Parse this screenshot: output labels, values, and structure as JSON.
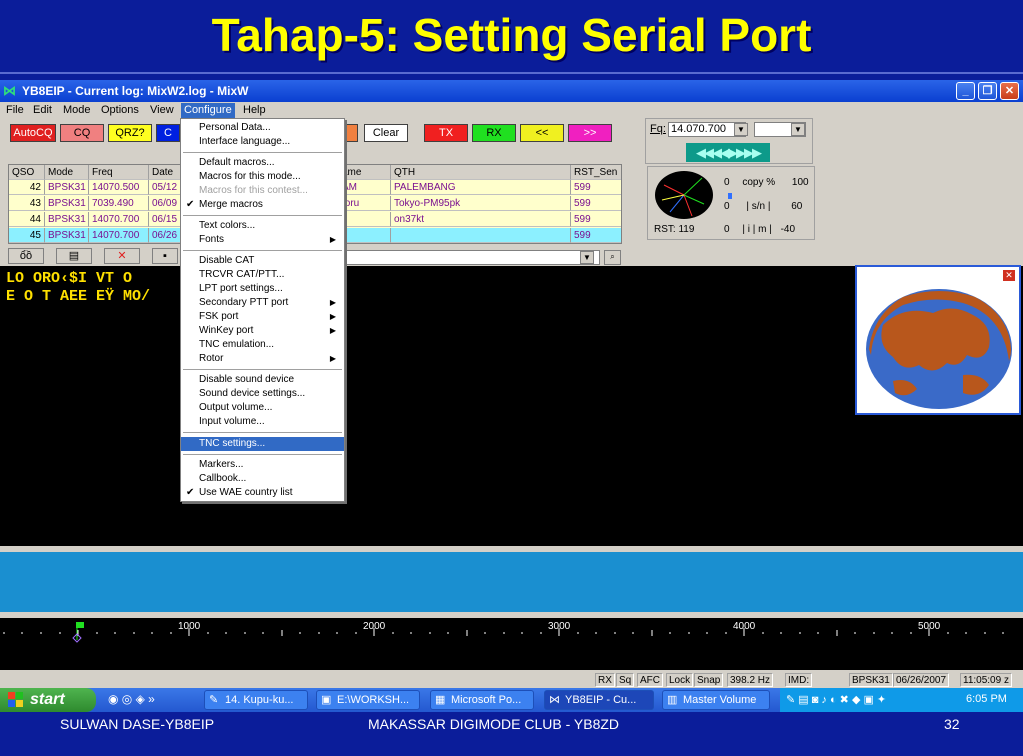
{
  "slide": {
    "title": "Tahap-5: Setting Serial Port",
    "footer_left": "SULWAN DASE-YB8EIP",
    "footer_center": "MAKASSAR DIGIMODE CLUB - YB8ZD",
    "footer_right": "32"
  },
  "window": {
    "title": "YB8EIP - Current log: MixW2.log - MixW",
    "controls": {
      "minimize": "_",
      "restore": "❐",
      "close": "✕"
    }
  },
  "menubar": [
    "File",
    "Edit",
    "Mode",
    "Options",
    "View",
    "Configure",
    "Help"
  ],
  "macro_buttons": {
    "autocq": "AutoCQ",
    "cq": "CQ",
    "qrz": "QRZ?",
    "c": "C",
    "clear": "Clear",
    "tx": "TX",
    "rx": "RX",
    "back": "<<",
    "fwd": ">>"
  },
  "freq": {
    "label": "Fq:",
    "value": "14.070.700",
    "tuner": "◀◀◀◀▶▶▶▶"
  },
  "meters": {
    "rst": "RST: 119",
    "row1": [
      "0",
      "copy %",
      "100"
    ],
    "row2": [
      "0",
      "| s/n |",
      "60"
    ],
    "row3": [
      "0",
      "| i | m |",
      "-40"
    ]
  },
  "qso_table": {
    "headers": [
      "QSO",
      "Mode",
      "Freq",
      "Date",
      "ame",
      "QTH",
      "RST_Sen"
    ],
    "rows": [
      {
        "qso": "42",
        "mode": "BPSK31",
        "freq": "14070.500",
        "date": "05/12",
        "name": "AM",
        "qth": "PALEMBANG",
        "rst": "599"
      },
      {
        "qso": "43",
        "mode": "BPSK31",
        "freq": "7039.490",
        "date": "06/09",
        "name": "toru",
        "qth": "Tokyo-PM95pk",
        "rst": "599"
      },
      {
        "qso": "44",
        "mode": "BPSK31",
        "freq": "14070.700",
        "date": "06/15",
        "name": "",
        "qth": "on37kt",
        "rst": "599"
      },
      {
        "qso": "45",
        "mode": "BPSK31",
        "freq": "14070.700",
        "date": "06/26",
        "name": "",
        "qth": "",
        "rst": "599"
      }
    ]
  },
  "rx_text": {
    "line1": "LO ORO‹$I VT O",
    "line2": "E O  T AEE EŸ MO/"
  },
  "configure_menu": {
    "items": [
      {
        "label": "Personal Data...",
        "state": "normal"
      },
      {
        "label": "Interface language...",
        "state": "normal"
      },
      {
        "label": "Default macros...",
        "state": "normal"
      },
      {
        "label": "Macros for this mode...",
        "state": "normal"
      },
      {
        "label": "Macros for this contest...",
        "state": "disabled"
      },
      {
        "label": "Merge macros",
        "state": "checked"
      },
      {
        "label": "Text colors...",
        "state": "normal"
      },
      {
        "label": "Fonts",
        "state": "submenu"
      },
      {
        "label": "Disable CAT",
        "state": "normal"
      },
      {
        "label": "TRCVR CAT/PTT...",
        "state": "normal"
      },
      {
        "label": "LPT port settings...",
        "state": "normal"
      },
      {
        "label": "Secondary PTT port",
        "state": "submenu"
      },
      {
        "label": "FSK port",
        "state": "submenu"
      },
      {
        "label": "WinKey port",
        "state": "submenu"
      },
      {
        "label": "TNC emulation...",
        "state": "normal"
      },
      {
        "label": "Rotor",
        "state": "submenu"
      },
      {
        "label": "Disable sound device",
        "state": "normal"
      },
      {
        "label": "Sound device settings...",
        "state": "normal"
      },
      {
        "label": "Output volume...",
        "state": "normal"
      },
      {
        "label": "Input volume...",
        "state": "normal"
      },
      {
        "label": "TNC settings...",
        "state": "highlighted"
      },
      {
        "label": "Markers...",
        "state": "normal"
      },
      {
        "label": "Callbook...",
        "state": "normal"
      },
      {
        "label": "Use WAE country list",
        "state": "checked"
      }
    ]
  },
  "ruler": [
    "1000",
    "2000",
    "3000",
    "4000",
    "5000"
  ],
  "statusbar": {
    "rx": "RX",
    "sq": "Sq",
    "afc": "AFC",
    "lock": "Lock",
    "snap": "Snap",
    "freq": "398.2 Hz",
    "imd": "IMD:",
    "mode": "BPSK31",
    "date": "06/26/2007",
    "time": "11:05:09 z"
  },
  "taskbar": {
    "start": "start",
    "items": [
      "14. Kupu-ku...",
      "E:\\WORKSH...",
      "Microsoft Po...",
      "YB8EIP - Cu...",
      "Master Volume"
    ],
    "clock": "6:05 PM"
  },
  "colors": {
    "slide_bg": "#0b1d9a",
    "title_yellow": "#ffff00",
    "menu_highlight": "#316ac5",
    "rx_text": "#ffe000"
  }
}
